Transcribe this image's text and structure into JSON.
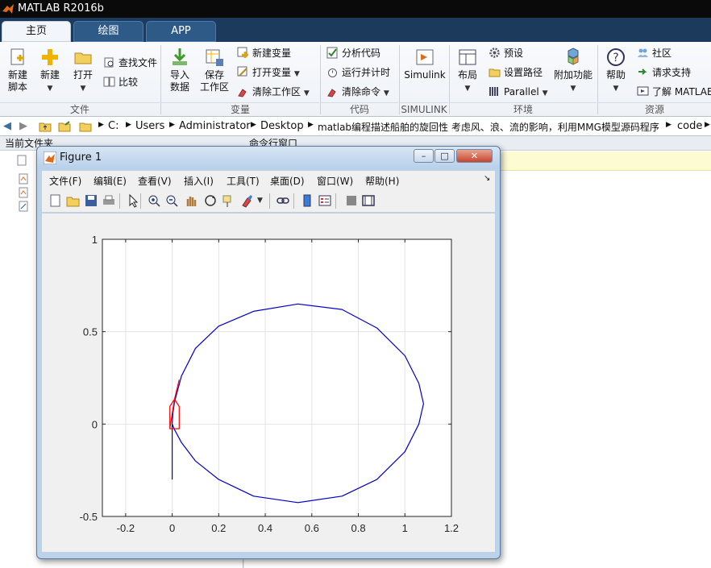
{
  "app": {
    "title": "MATLAB R2016b"
  },
  "tabs": [
    "主页",
    "绘图",
    "APP"
  ],
  "ribbon": {
    "new_script": [
      "新建",
      "脚本"
    ],
    "new": "新建",
    "open": "打开",
    "find_files": "查找文件",
    "compare": "比较",
    "import": [
      "导入",
      "数据"
    ],
    "save_ws": [
      "保存",
      "工作区"
    ],
    "new_var": "新建变量",
    "open_var": "打开变量",
    "clear_ws": "清除工作区",
    "analyze": "分析代码",
    "run_time": "运行并计时",
    "clear_cmd": "清除命令",
    "simulink": "Simulink",
    "layout": "布局",
    "prefs": "预设",
    "set_path": "设置路径",
    "parallel": "Parallel",
    "addons": "附加功能",
    "help": "帮助",
    "community": "社区",
    "support": "请求支持",
    "learn": "了解 MATLAB",
    "groups": [
      "文件",
      "变量",
      "代码",
      "SIMULINK",
      "环境",
      "资源"
    ]
  },
  "address": {
    "crumbs": [
      "C:",
      "Users",
      "Administrator",
      "Desktop",
      "matlab编程描述船舶的旋回性 考虑风、浪、流的影响，利用MMG模型源码程序",
      "code"
    ]
  },
  "panels": {
    "current_folder": "当前文件夹",
    "command_window": "命令行窗口"
  },
  "figure": {
    "title": "Figure 1",
    "menu": [
      "文件(F)",
      "编辑(E)",
      "查看(V)",
      "插入(I)",
      "工具(T)",
      "桌面(D)",
      "窗口(W)",
      "帮助(H)"
    ],
    "toolbar_icons": [
      "new-figure-icon",
      "open-file-icon",
      "save-icon",
      "print-icon",
      "pointer-icon",
      "zoom-in-icon",
      "zoom-out-icon",
      "pan-icon",
      "rotate-icon",
      "data-cursor-icon",
      "brush-icon",
      "link-icon",
      "colorbar-icon",
      "legend-icon",
      "hide-plot-tools-icon",
      "show-plot-tools-icon"
    ]
  },
  "chart_data": {
    "type": "line",
    "xlim": [
      -0.3,
      1.2
    ],
    "ylim": [
      -0.5,
      1
    ],
    "xticks": [
      "-0.2",
      "0",
      "0.2",
      "0.4",
      "0.6",
      "0.8",
      "1",
      "1.2"
    ],
    "xtick_values": [
      -0.2,
      0,
      0.2,
      0.4,
      0.6,
      0.8,
      1,
      1.2
    ],
    "yticks": [
      "-0.5",
      "0",
      "0.5",
      "1"
    ],
    "ytick_values": [
      -0.5,
      0,
      0.5,
      1
    ],
    "grid": true,
    "series": [
      {
        "color": "#0000cc",
        "x": [
          0,
          0,
          0.003,
          0.01,
          0.04,
          0.1,
          0.2,
          0.35,
          0.54,
          0.73,
          0.88,
          1.0,
          1.06,
          1.08,
          1.06,
          1.0,
          0.88,
          0.73,
          0.54,
          0.35,
          0.2,
          0.1,
          0.04,
          0.01,
          0.0
        ],
        "y": [
          -0.3,
          0.0,
          0.06,
          0.12,
          0.26,
          0.41,
          0.53,
          0.61,
          0.65,
          0.62,
          0.52,
          0.37,
          0.22,
          0.11,
          0.0,
          -0.15,
          -0.3,
          -0.39,
          -0.425,
          -0.39,
          -0.3,
          -0.2,
          -0.1,
          -0.03,
          0.0
        ]
      },
      {
        "color": "#ff0000",
        "x": [
          -0.01,
          0.03,
          0.03,
          0.01,
          -0.01,
          -0.01,
          0.01,
          0.03
        ],
        "y": [
          -0.025,
          -0.025,
          0.095,
          0.135,
          0.095,
          -0.025,
          0.135,
          0.24
        ]
      }
    ]
  }
}
